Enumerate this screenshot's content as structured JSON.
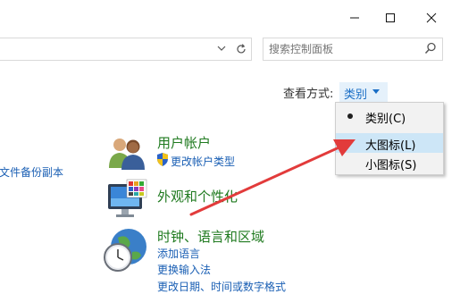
{
  "window": {
    "minimize_icon": "minimize-icon",
    "maximize_icon": "maximize-icon",
    "close_icon": "close-icon"
  },
  "address": {
    "refresh_icon": "refresh-icon",
    "dropdown_icon": "chevron-down-icon"
  },
  "search": {
    "placeholder": "搜索控制面板",
    "icon": "search-icon"
  },
  "view_by": {
    "label": "查看方式:",
    "value": "类别"
  },
  "menu": {
    "items": [
      {
        "label": "类别(C)",
        "selected": true
      },
      {
        "label": "大图标(L)",
        "selected": false
      },
      {
        "label": "小图标(S)",
        "selected": false
      }
    ]
  },
  "left_partial_link": "文件备份副本",
  "categories": [
    {
      "title": "用户帐户",
      "icon": "users-icon",
      "links": [
        "更改帐户类型"
      ],
      "link_icon": "uac-shield-icon"
    },
    {
      "title": "外观和个性化",
      "icon": "display-icon",
      "links": []
    },
    {
      "title": "时钟、语言和区域",
      "icon": "clock-globe-icon",
      "links": [
        "添加语言",
        "更换输入法",
        "更改日期、时间或数字格式"
      ]
    }
  ],
  "annotation": {
    "arrow_color": "#e23b3b"
  }
}
